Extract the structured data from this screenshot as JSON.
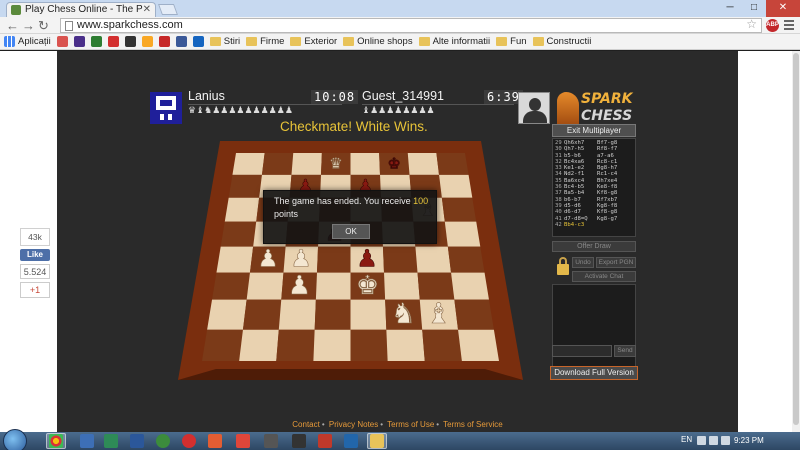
{
  "browser": {
    "tab_title": "Play Chess Online - The P",
    "url": "www.sparkchess.com",
    "bookmarks": [
      {
        "label": "Aplicații",
        "kind": "apps"
      },
      {
        "label": "",
        "color": "#d9534f"
      },
      {
        "label": "",
        "color": "#4a2f8a"
      },
      {
        "label": "",
        "color": "#2e7d32"
      },
      {
        "label": "",
        "color": "#d32f2f"
      },
      {
        "label": "",
        "color": "#333333"
      },
      {
        "label": "",
        "color": "#f9a825"
      },
      {
        "label": "",
        "color": "#c62828"
      },
      {
        "label": "",
        "color": "#3b5998"
      },
      {
        "label": "",
        "color": "#1565c0"
      },
      {
        "label": "Stiri",
        "kind": "folder"
      },
      {
        "label": "Firme",
        "kind": "folder"
      },
      {
        "label": "Exterior",
        "kind": "folder"
      },
      {
        "label": "Online shops",
        "kind": "folder"
      },
      {
        "label": "Alte informatii",
        "kind": "folder"
      },
      {
        "label": "Fun",
        "kind": "folder"
      },
      {
        "label": "Constructii",
        "kind": "folder"
      }
    ]
  },
  "social": {
    "likes_count": "43k",
    "like_label": "Like",
    "fb_count": "5.524",
    "gplus_label": "+1"
  },
  "game": {
    "player1": {
      "name": "Lanius",
      "timer": "10:08",
      "captured": "♛♝♞♟♟♟♟♟♟♟♟♟♟"
    },
    "player2": {
      "name": "Guest_314991",
      "timer": "6:39",
      "captured": "♝♟♟♟♟♟♟♟♟"
    },
    "logo_line1": "SPARK",
    "logo_line2": "CHESS",
    "status": "Checkmate! White Wins.",
    "exit_label": "Exit Multiplayer",
    "moves": [
      {
        "n": "",
        "w": "Qh6xh7",
        "b": "Bf7-g8"
      },
      {
        "n": "",
        "w": "Qh7-h5",
        "b": "Rf8-f7"
      },
      {
        "n": "",
        "w": "b5-b6",
        "b": "a7-a6"
      },
      {
        "n": "",
        "w": "Bc4xa6",
        "b": "Rc8-c1"
      },
      {
        "n": "",
        "w": "Ke1-e2",
        "b": "Bg8-h7"
      },
      {
        "n": "",
        "w": "Nd2-f1",
        "b": "Rc1-c4"
      },
      {
        "n": "",
        "w": "Ba6xc4",
        "b": "Bh7xe4"
      },
      {
        "n": "",
        "w": "Bc4-b5",
        "b": "Ke8-f8"
      },
      {
        "n": "",
        "w": "Ba5-b4",
        "b": "Kf8-g8"
      },
      {
        "n": "",
        "w": "b6-b7",
        "b": "Rf7xb7"
      },
      {
        "n": "",
        "w": "d5-d6",
        "b": "Kg8-f8"
      },
      {
        "n": "",
        "w": "d6-d7",
        "b": "Kf8-g8"
      },
      {
        "n": "",
        "w": "d7-d8=Q",
        "b": "Kg8-g7"
      },
      {
        "n": "",
        "w": "Bb4-c3",
        "b": "",
        "highlight": true
      }
    ],
    "offer_draw": "Offer Draw",
    "btn_undo": "Undo",
    "btn_export": "Export PGN",
    "btn_chat": "Activate Chat",
    "btn_send": "Send",
    "download_label": "Download Full Version",
    "dialog": {
      "msg_prefix": "The game has ended. You receive",
      "points": "100",
      "msg_suffix": "points",
      "ok": "OK"
    },
    "footer": [
      "Contact",
      "Privacy Notes",
      "Terms of Use",
      "Terms of Service"
    ]
  },
  "taskbar": {
    "lang": "EN",
    "time": "9:23 PM"
  }
}
